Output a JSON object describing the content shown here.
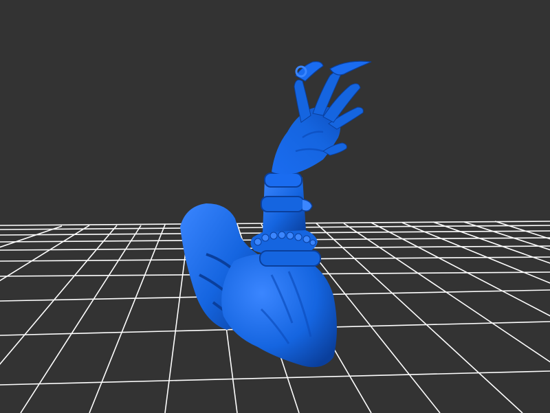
{
  "viewer": {
    "background_color": "#333333",
    "grid_color": "#ffffff",
    "model_color": "#1565e0",
    "model_highlight": "#3b86ff",
    "model_shadow": "#0a3f9c",
    "grid_visible": true
  }
}
